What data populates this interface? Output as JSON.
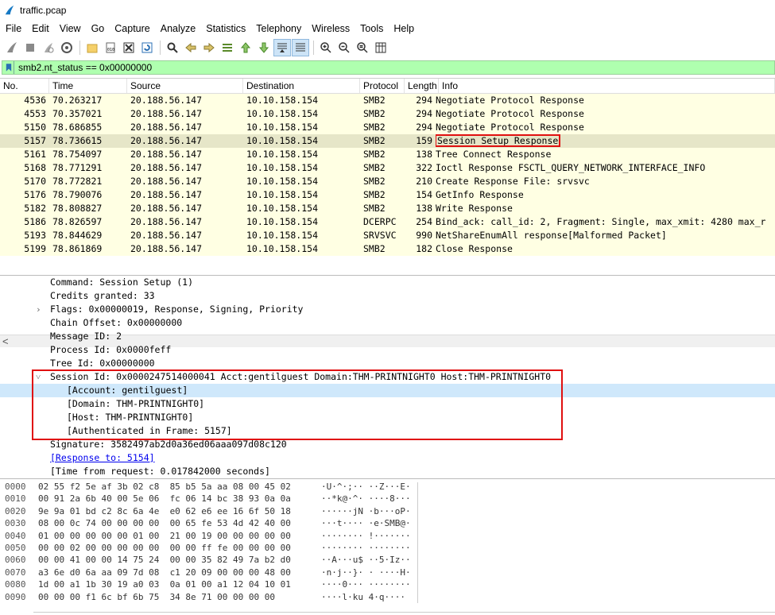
{
  "window": {
    "title": "traffic.pcap"
  },
  "menu": [
    "File",
    "Edit",
    "View",
    "Go",
    "Capture",
    "Analyze",
    "Statistics",
    "Telephony",
    "Wireless",
    "Tools",
    "Help"
  ],
  "filter": {
    "value": "smb2.nt_status == 0x00000000"
  },
  "packet_list": {
    "columns": [
      "No.",
      "Time",
      "Source",
      "Destination",
      "Protocol",
      "Length",
      "Info"
    ],
    "rows": [
      {
        "no": "4536",
        "time": "70.263217",
        "src": "20.188.56.147",
        "dst": "10.10.158.154",
        "proto": "SMB2",
        "len": "294",
        "info": "Negotiate Protocol Response"
      },
      {
        "no": "4553",
        "time": "70.357021",
        "src": "20.188.56.147",
        "dst": "10.10.158.154",
        "proto": "SMB2",
        "len": "294",
        "info": "Negotiate Protocol Response"
      },
      {
        "no": "5150",
        "time": "78.686855",
        "src": "20.188.56.147",
        "dst": "10.10.158.154",
        "proto": "SMB2",
        "len": "294",
        "info": "Negotiate Protocol Response"
      },
      {
        "no": "5157",
        "time": "78.736615",
        "src": "20.188.56.147",
        "dst": "10.10.158.154",
        "proto": "SMB2",
        "len": "159",
        "info": "Session Setup Response",
        "selected": true
      },
      {
        "no": "5161",
        "time": "78.754097",
        "src": "20.188.56.147",
        "dst": "10.10.158.154",
        "proto": "SMB2",
        "len": "138",
        "info": "Tree Connect Response"
      },
      {
        "no": "5168",
        "time": "78.771291",
        "src": "20.188.56.147",
        "dst": "10.10.158.154",
        "proto": "SMB2",
        "len": "322",
        "info": "Ioctl Response FSCTL_QUERY_NETWORK_INTERFACE_INFO"
      },
      {
        "no": "5170",
        "time": "78.772821",
        "src": "20.188.56.147",
        "dst": "10.10.158.154",
        "proto": "SMB2",
        "len": "210",
        "info": "Create Response File: srvsvc"
      },
      {
        "no": "5176",
        "time": "78.790076",
        "src": "20.188.56.147",
        "dst": "10.10.158.154",
        "proto": "SMB2",
        "len": "154",
        "info": "GetInfo Response"
      },
      {
        "no": "5182",
        "time": "78.808827",
        "src": "20.188.56.147",
        "dst": "10.10.158.154",
        "proto": "SMB2",
        "len": "138",
        "info": "Write Response"
      },
      {
        "no": "5186",
        "time": "78.826597",
        "src": "20.188.56.147",
        "dst": "10.10.158.154",
        "proto": "DCERPC",
        "len": "254",
        "info": "Bind_ack: call_id: 2, Fragment: Single, max_xmit: 4280 max_r"
      },
      {
        "no": "5193",
        "time": "78.844629",
        "src": "20.188.56.147",
        "dst": "10.10.158.154",
        "proto": "SRVSVC",
        "len": "990",
        "info": "NetShareEnumAll response[Malformed Packet]"
      },
      {
        "no": "5199",
        "time": "78.861869",
        "src": "20.188.56.147",
        "dst": "10.10.158.154",
        "proto": "SMB2",
        "len": "182",
        "info": "Close Response"
      }
    ]
  },
  "details": [
    {
      "indent": 63,
      "text": "Command: Session Setup (1)"
    },
    {
      "indent": 63,
      "text": "Credits granted: 33"
    },
    {
      "indent": 63,
      "text": "Flags: 0x00000019, Response, Signing, Priority",
      "expander": ">"
    },
    {
      "indent": 63,
      "text": "Chain Offset: 0x00000000"
    },
    {
      "indent": 63,
      "text": "Message ID: 2"
    },
    {
      "indent": 63,
      "text": "Process Id: 0x0000feff"
    },
    {
      "indent": 63,
      "text": "Tree Id: 0x00000000"
    },
    {
      "indent": 63,
      "text": "Session Id: 0x0000247514000041 Acct:gentilguest Domain:THM-PRINTNIGHT0 Host:THM-PRINTNIGHT0",
      "expander": "v"
    },
    {
      "indent": 84,
      "text": "[Account: gentilguest]",
      "highlight": true
    },
    {
      "indent": 84,
      "text": "[Domain: THM-PRINTNIGHT0]"
    },
    {
      "indent": 84,
      "text": "[Host: THM-PRINTNIGHT0]"
    },
    {
      "indent": 84,
      "text": "[Authenticated in Frame: 5157]"
    },
    {
      "indent": 63,
      "text": "Signature: 3582497ab2d0a36ed06aaa097d08c120"
    },
    {
      "indent": 63,
      "text": "[Response to: 5154]",
      "link": true
    },
    {
      "indent": 63,
      "text": "[Time from request: 0.017842000 seconds]"
    }
  ],
  "bytes": [
    {
      "off": "0000",
      "hex": "02 55 f2 5e af 3b 02 c8  85 b5 5a aa 08 00 45 02",
      "ascii": "·U·^·;·· ··Z···E·"
    },
    {
      "off": "0010",
      "hex": "00 91 2a 6b 40 00 5e 06  fc 06 14 bc 38 93 0a 0a",
      "ascii": "··*k@·^· ····8···"
    },
    {
      "off": "0020",
      "hex": "9e 9a 01 bd c2 8c 6a 4e  e0 62 e6 ee 16 6f 50 18",
      "ascii": "······jN ·b···oP·"
    },
    {
      "off": "0030",
      "hex": "08 00 0c 74 00 00 00 00  00 65 fe 53 4d 42 40 00",
      "ascii": "···t···· ·e·SMB@·"
    },
    {
      "off": "0040",
      "hex": "01 00 00 00 00 00 01 00  21 00 19 00 00 00 00 00",
      "ascii": "········ !·······"
    },
    {
      "off": "0050",
      "hex": "00 00 02 00 00 00 00 00  00 00 ff fe 00 00 00 00",
      "ascii": "········ ········"
    },
    {
      "off": "0060",
      "hex": "00 00 41 00 00 14 75 24  00 00 35 82 49 7a b2 d0",
      "ascii": "··A···u$ ··5·Iz··"
    },
    {
      "off": "0070",
      "hex": "a3 6e d0 6a aa 09 7d 08  c1 20 09 00 00 00 48 00",
      "ascii": "·n·j··}· · ····H·"
    },
    {
      "off": "0080",
      "hex": "1d 00 a1 1b 30 19 a0 03  0a 01 00 a1 12 04 10 01",
      "ascii": "····0··· ········"
    },
    {
      "off": "0090",
      "hex": "00 00 00 f1 6c bf 6b 75  34 8e 71 00 00 00 00",
      "ascii": "····l·ku 4·q····"
    }
  ],
  "colors": {
    "filter_bg": "#afffaf",
    "row_bg": "#ffffe3",
    "selected_row_bg": "#e6e6c8",
    "highlight": "#e01010",
    "tree_selected": "#cfe8fb"
  }
}
